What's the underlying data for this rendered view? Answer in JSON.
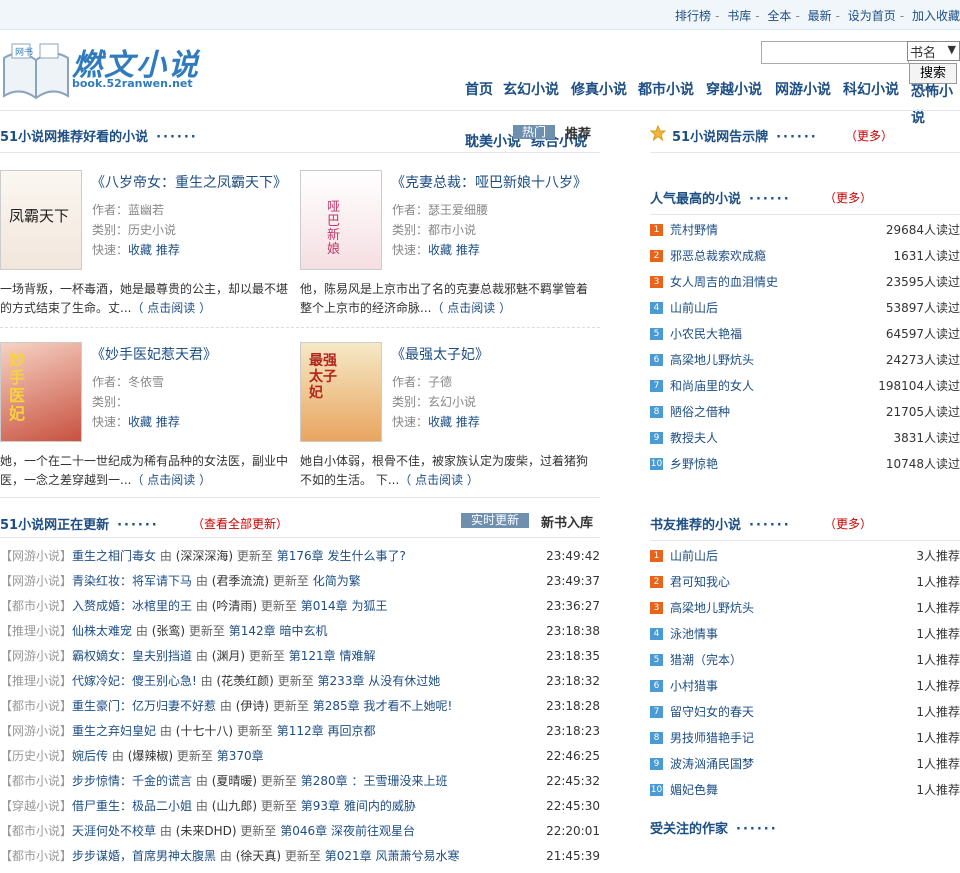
{
  "topbar": {
    "links": [
      "排行榜",
      "书库",
      "全本",
      "最新",
      "设为首页",
      "加入收藏"
    ]
  },
  "logo": {
    "title": "燃文小说",
    "domain": "book.52ranwen.net",
    "badge": "网书"
  },
  "search": {
    "select": "书名",
    "button": "搜索"
  },
  "nav": [
    "首页",
    "玄幻小说",
    "修真小说",
    "都市小说",
    "穿越小说",
    "网游小说",
    "科幻小说",
    "恐怖小说",
    "耽美小说",
    "综合小说"
  ],
  "recommend": {
    "title": "51小说网推荐好看的小说",
    "dots": "······",
    "tab_hot": "热门",
    "tab_rec": "推荐",
    "books": [
      {
        "title": "《八岁帝女：重生之凤霸天下》",
        "author_label": "作者：",
        "author": "蓝幽若",
        "type_label": "类别：",
        "type": "历史小说",
        "quick_label": "快速：",
        "collect": "收藏",
        "rec": "推荐",
        "desc": "一场背叛，一杯毒酒，她是最尊贵的公主，却以最不堪的方式结束了生命。丈...",
        "read": "（ 点击阅读 ）",
        "cover_text": "凤霸天下"
      },
      {
        "title": "《克妻总裁：哑巴新娘十八岁》",
        "author_label": "作者：",
        "author": "瑟王爱细腰",
        "type_label": "类别：",
        "type": "都市小说",
        "quick_label": "快速：",
        "collect": "收藏",
        "rec": "推荐",
        "desc": "他，陈易风是上京市出了名的克妻总裁邪魅不羁掌管着整个上京市的经济命脉...",
        "read": "（ 点击阅读 ）",
        "cover_text": "哑巴新娘"
      },
      {
        "title": "《妙手医妃惹天君》",
        "author_label": "作者：",
        "author": "冬依雪",
        "type_label": "类别：",
        "type": "",
        "quick_label": "快速：",
        "collect": "收藏",
        "rec": "推荐",
        "desc": "她，一个在二十一世纪成为稀有品种的女法医，副业中医，一念之差穿越到一...",
        "read": "（ 点击阅读 ）",
        "cover_text": "妙手医妃"
      },
      {
        "title": "《最强太子妃》",
        "author_label": "作者：",
        "author": "子德",
        "type_label": "类别：",
        "type": "玄幻小说",
        "quick_label": "快速：",
        "collect": "收藏",
        "rec": "推荐",
        "desc": "她自小体弱，根骨不佳，被家族认定为废柴，过着猪狗不如的生活。 下...",
        "read": "（ 点击阅读 ）",
        "cover_text": "最强太子妃"
      }
    ]
  },
  "updates": {
    "title": "51小说网正在更新",
    "dots": "······",
    "more": "（查看全部更新）",
    "btn_live": "实时更新",
    "tab_new": "新书入库",
    "by": "由",
    "upd": "更新至",
    "rows": [
      {
        "cat": "【网游小说】",
        "name": "重生之相门毒女",
        "author": "(深深深海)",
        "chapter": "第176章 发生什么事了?",
        "time": "23:49:42"
      },
      {
        "cat": "【网游小说】",
        "name": "青染红妆：将军请下马",
        "author": "(君季流流)",
        "chapter": "化简为繁",
        "time": "23:49:37"
      },
      {
        "cat": "【都市小说】",
        "name": "入赘成婚：冰棺里的王",
        "author": "(吟清雨)",
        "chapter": "第014章 为狐王",
        "time": "23:36:27"
      },
      {
        "cat": "【推理小说】",
        "name": "仙株太难宠",
        "author": "(张鸾)",
        "chapter": "第142章 暗中玄机",
        "time": "23:18:38"
      },
      {
        "cat": "【网游小说】",
        "name": "霸权嫡女：皇夫别挡道",
        "author": "(渊月)",
        "chapter": "第121章 情难解",
        "time": "23:18:35"
      },
      {
        "cat": "【推理小说】",
        "name": "代嫁冷妃：傻王别心急!",
        "author": "(花羡红颜)",
        "chapter": "第233章 从没有休过她",
        "time": "23:18:32"
      },
      {
        "cat": "【都市小说】",
        "name": "重生豪门：亿万归妻不好惹",
        "author": "(伊诗)",
        "chapter": "第285章 我才看不上她呢!",
        "time": "23:18:28"
      },
      {
        "cat": "【网游小说】",
        "name": "重生之弃妇皇妃",
        "author": "(十七十八)",
        "chapter": "第112章 再回京都",
        "time": "23:18:23"
      },
      {
        "cat": "【历史小说】",
        "name": "婉后传",
        "author": "(爆辣椒)",
        "chapter": "第370章",
        "time": "22:46:25"
      },
      {
        "cat": "【都市小说】",
        "name": "步步惊情：千金的谎言",
        "author": "(夏晴暖)",
        "chapter": "第280章 ：王雪珊没来上班",
        "time": "22:45:32"
      },
      {
        "cat": "【穿越小说】",
        "name": "借尸重生：极品二小姐",
        "author": "(山九郎)",
        "chapter": "第93章 雅间内的威胁",
        "time": "22:45:30"
      },
      {
        "cat": "【都市小说】",
        "name": "天涯何处不校草",
        "author": "(未来DHD)",
        "chapter": "第046章 深夜前往观星台",
        "time": "22:20:01"
      },
      {
        "cat": "【都市小说】",
        "name": "步步谋婚，首席男神太腹黑",
        "author": "(徐天真)",
        "chapter": "第021章 风萧萧兮易水寒",
        "time": "21:45:39"
      }
    ]
  },
  "notice": {
    "title": "51小说网告示牌",
    "dots": "······",
    "more": "（更多）"
  },
  "popular": {
    "title": "人气最高的小说",
    "dots": "······",
    "more": "（更多）",
    "items": [
      {
        "n": "1",
        "name": "荒村野情",
        "count": "29684人读过"
      },
      {
        "n": "2",
        "name": "邪恶总裁索欢成瘾",
        "count": "1631人读过"
      },
      {
        "n": "3",
        "name": "女人周吉的血泪情史",
        "count": "23595人读过"
      },
      {
        "n": "4",
        "name": "山前山后",
        "count": "53897人读过"
      },
      {
        "n": "5",
        "name": "小农民大艳福",
        "count": "64597人读过"
      },
      {
        "n": "6",
        "name": "高梁地儿野炕头",
        "count": "24273人读过"
      },
      {
        "n": "7",
        "name": "和尚庙里的女人",
        "count": "198104人读过"
      },
      {
        "n": "8",
        "name": "陋俗之借种",
        "count": "21705人读过"
      },
      {
        "n": "9",
        "name": "教授夫人",
        "count": "3831人读过"
      },
      {
        "n": "10",
        "name": "乡野惊艳",
        "count": "10748人读过"
      }
    ]
  },
  "friends": {
    "title": "书友推荐的小说",
    "dots": "······",
    "more": "（更多）",
    "items": [
      {
        "n": "1",
        "name": "山前山后",
        "count": "3人推荐"
      },
      {
        "n": "2",
        "name": "君可知我心",
        "count": "1人推荐"
      },
      {
        "n": "3",
        "name": "高梁地儿野炕头",
        "count": "1人推荐"
      },
      {
        "n": "4",
        "name": "泳池情事",
        "count": "1人推荐"
      },
      {
        "n": "5",
        "name": "猎潮（完本）",
        "count": "1人推荐"
      },
      {
        "n": "6",
        "name": "小村猎事",
        "count": "1人推荐"
      },
      {
        "n": "7",
        "name": "留守妇女的春天",
        "count": "1人推荐"
      },
      {
        "n": "8",
        "name": "男技师猎艳手记",
        "count": "1人推荐"
      },
      {
        "n": "9",
        "name": "波涛汹涌民国梦",
        "count": "1人推荐"
      },
      {
        "n": "10",
        "name": "媚妃色舞",
        "count": "1人推荐"
      }
    ]
  },
  "authors": {
    "title": "受关注的作家",
    "dots": "······"
  },
  "colors": {
    "link": "#1d4e84",
    "accent_red": "#cc0000",
    "tab_bg": "#6f8faf",
    "rank_top": "#e8641b",
    "rank_rest": "#4a9ad4"
  }
}
